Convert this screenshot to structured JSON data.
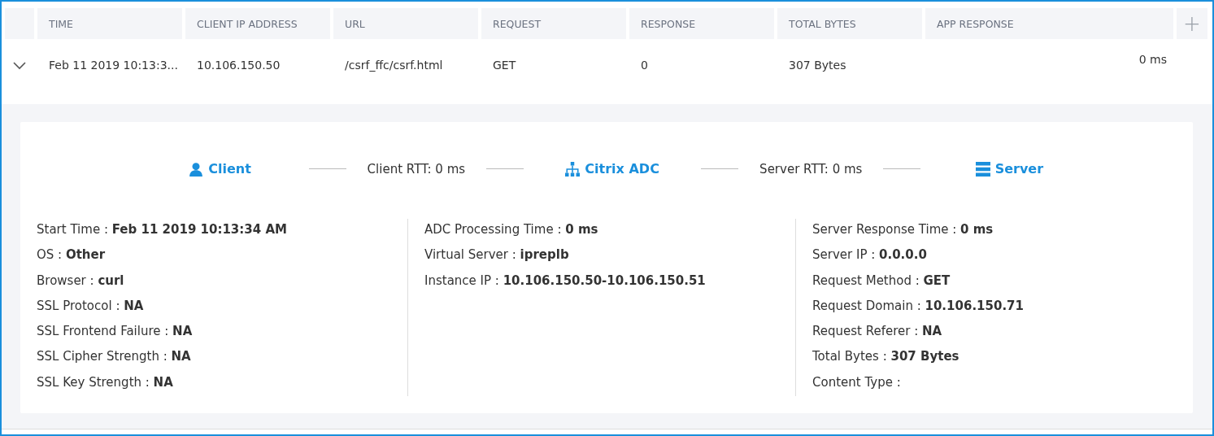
{
  "table": {
    "columns": [
      "TIME",
      "CLIENT IP ADDRESS",
      "URL",
      "REQUEST",
      "RESPONSE",
      "TOTAL BYTES",
      "APP RESPONSE"
    ],
    "add_column": "+",
    "rows": [
      {
        "expanded": true,
        "cells": [
          "Feb 11 2019 10:13:3...",
          "10.106.150.50",
          "/csrf_ffc/csrf.html",
          "GET",
          "0",
          "307 Bytes",
          "0 ms"
        ]
      }
    ]
  },
  "flow": [
    {
      "kind": "node",
      "label": "Client"
    },
    {
      "kind": "link",
      "label": "Client RTT: 0 ms"
    },
    {
      "kind": "node",
      "label": "Citrix ADC"
    },
    {
      "kind": "link",
      "label": "Server RTT: 0 ms"
    },
    {
      "kind": "node",
      "label": "Server"
    }
  ],
  "details": [
    [
      "Start Time : **Feb 11 2019 10:13:34 AM**",
      "OS : **Other**",
      "Browser : **curl**",
      "SSL Protocol : **NA**",
      "SSL Frontend Failure : **NA**",
      "SSL Cipher Strength : **NA**",
      "SSL Key Strength : **NA**"
    ],
    [
      "ADC Processing Time : **0 ms**",
      "Virtual Server : **ipreplb**",
      "Instance IP : **10.106.150.50-10.106.150.51**"
    ],
    [
      "Server Response Time : **0 ms**",
      "Server IP : **0.0.0.0**",
      "Request Method : **GET**",
      "Request Domain : **10.106.150.71**",
      "Request Referer : **NA**",
      "Total Bytes : **307 Bytes**",
      "Content Type :"
    ]
  ]
}
